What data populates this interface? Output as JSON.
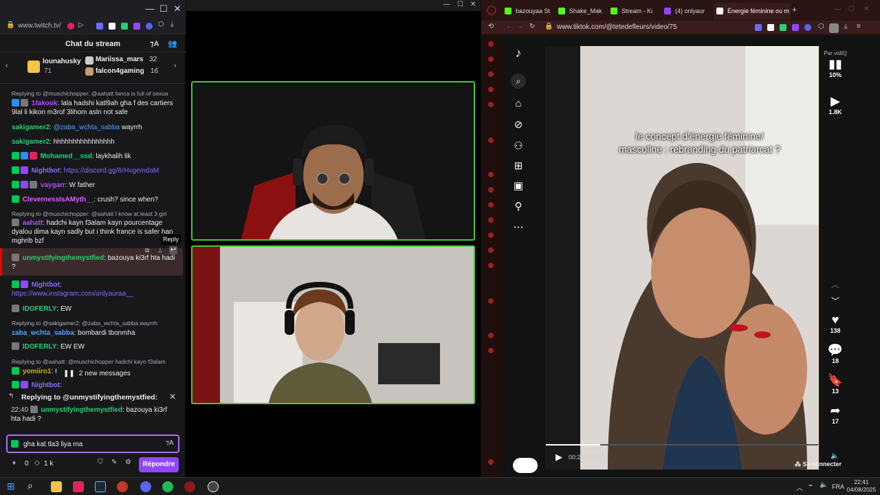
{
  "chat_window": {
    "url": "www.twitch.tv/",
    "header_title": "Chat du stream",
    "leaderboard": [
      {
        "name": "lounahusky",
        "count": "71"
      },
      {
        "name": "Mariissa_mars",
        "count": "32"
      },
      {
        "name": "falcon4gaming",
        "count": "16"
      }
    ],
    "messages": [
      {
        "reply_to": "Replying to @muschichopper: @aahatt fanca is full of sexua"
      },
      {
        "user": "1fakook",
        "text": ": lala hadshi katl9ah gha f des cartiers 9lal li kikon m3rof 3lihom asln not safe"
      },
      {
        "user": "sakigamer2",
        "mention": "@zaba_wchta_sabba",
        "text": " wayrrh"
      },
      {
        "user": "sakigamer2",
        "text": ": hhhhhhhhhhhhhhhh"
      },
      {
        "user": "Mohamed__ssd",
        "text": ": laykhalih lik"
      },
      {
        "user": "Nightbot",
        "text": ": ",
        "link": "https://discord.gg/6rHvgemdaM"
      },
      {
        "user": "vaygarr",
        "text": ": W father"
      },
      {
        "user": "ClevernessIsAMyth__",
        "text": ": crush? since when?"
      },
      {
        "reply_to": "Replying to @muschichopper: @aahatt I know at least 3 girl"
      },
      {
        "user": "aahatt",
        "text": ": hadchi kayn f3alam kayn pourcentage dyalou dima kayn sadly but i think france is safer han mghrib bzf"
      },
      {
        "user": "unmystifyingthemystfied",
        "text": ": bazouya ki3rf hta hadi ?"
      },
      {
        "user": "Nightbot",
        "text": ":",
        "link": "https://www.instagram.com/onlyauraa__"
      },
      {
        "user": "IDOFERLY",
        "text": ": EW"
      },
      {
        "reply_to": "Replying to @sakigamer2: @zaba_wchta_sabba wayrrh"
      },
      {
        "user": "zaba_wchta_sabba",
        "text": ": bombardi tbonmha"
      },
      {
        "user": "IDOFERLY",
        "text": ": EW EW"
      },
      {
        "reply_to": "Replying to @aahatt: @muschichopper hadchi kayn f3alam"
      },
      {
        "user": "yomiiro1",
        "text": ": I a"
      },
      {
        "user": "Nightbot",
        "text": ":"
      }
    ],
    "hover_tooltip": "Reply",
    "new_messages": "2 new messages",
    "reply_box": {
      "title": "Replying to @unmystifyingthemystfied:",
      "time": "22:40",
      "user": "unmystifyingthemystfied",
      "text": ": bazouya ki3rf hta hadi ?"
    },
    "input_value": "gha kat tla3 liya ma",
    "points": "0",
    "viewers": "1 k",
    "reply_button": "Répondre"
  },
  "browser": {
    "tabs": [
      {
        "label": "bazouyaa St",
        "color": "#53fc18"
      },
      {
        "label": "Shake_Mak",
        "color": "#53fc18"
      },
      {
        "label": "Stream - Ki",
        "color": "#53fc18"
      },
      {
        "label": "(4) onlyaur",
        "color": "#9147ff"
      },
      {
        "label": "Énergie féminine ou m",
        "color": "#ffffff"
      }
    ],
    "url": "www.tiktok.com/@tetedefleurs/video/75",
    "video_caption_1": "le concept d’énergie féminine/",
    "video_caption_2": "masculine : rebranding du patriarcat ?",
    "time": "00:23 / 01:57",
    "vidiq_label": "Par vidIQ",
    "vidiq_pct": "10%",
    "plays": "1.8K",
    "likes": "138",
    "comments": "18",
    "saves": "13",
    "shares": "17",
    "login": "Se connecter"
  },
  "taskbar": {
    "lang": "FRA",
    "time": "22:41",
    "date": "04/08/2025"
  }
}
